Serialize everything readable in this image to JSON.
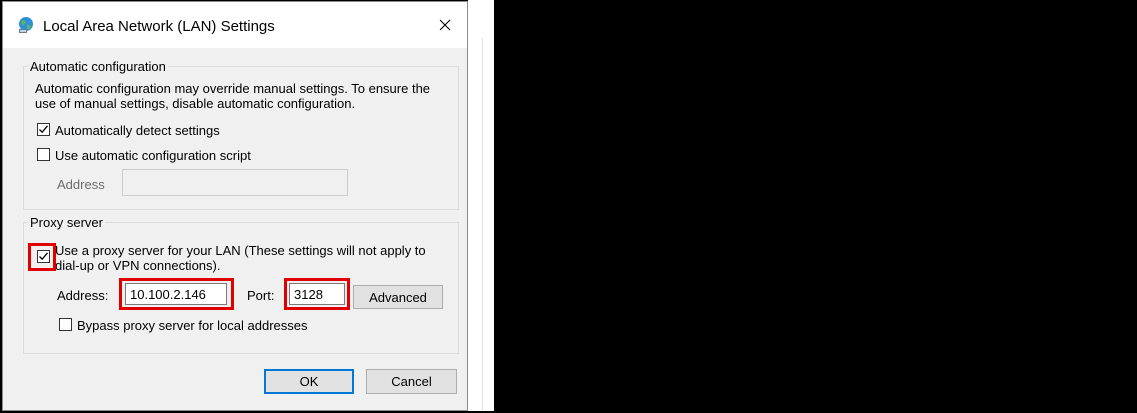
{
  "window": {
    "title": "Local Area Network (LAN) Settings"
  },
  "auto_config": {
    "legend": "Automatic configuration",
    "description_line1": "Automatic configuration may override manual settings.  To ensure the",
    "description_line2": "use of manual settings, disable automatic configuration.",
    "detect_label": "Automatically detect settings",
    "detect_checked": true,
    "script_label": "Use automatic configuration script",
    "script_checked": false,
    "address_label": "Address",
    "address_value": ""
  },
  "proxy": {
    "legend": "Proxy server",
    "use_proxy_line1": "Use a proxy server for your LAN (These settings will not apply to",
    "use_proxy_line2": "dial-up or VPN connections).",
    "use_proxy_checked": true,
    "address_label": "Address:",
    "address_value": "10.100.2.146",
    "port_label": "Port:",
    "port_value": "3128",
    "advanced_label": "Advanced",
    "bypass_label": "Bypass proxy server for local addresses",
    "bypass_checked": false
  },
  "buttons": {
    "ok_label": "OK",
    "cancel_label": "Cancel"
  },
  "colors": {
    "highlight": "#e10000",
    "focus": "#0078d7"
  }
}
